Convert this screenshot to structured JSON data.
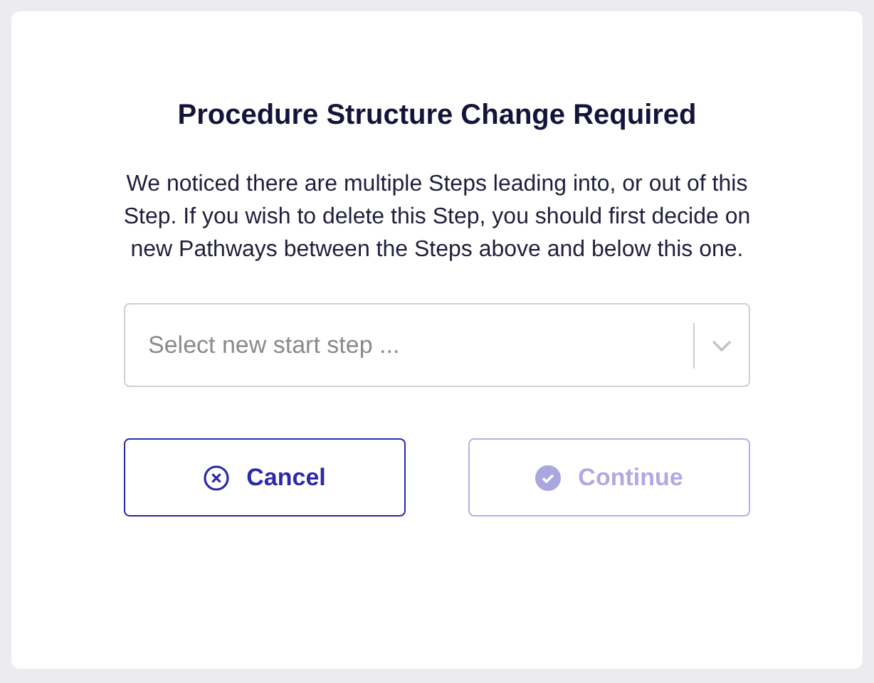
{
  "dialog": {
    "title": "Procedure Structure Change Required",
    "message": "We noticed there are multiple Steps leading into, or out of this Step. If you wish to delete this Step, you should first decide on new Pathways between the Steps above and below this one.",
    "select": {
      "placeholder": "Select new start step ..."
    },
    "buttons": [
      {
        "label": "Cancel",
        "kind": "cancel",
        "disabled": false
      },
      {
        "label": "Continue",
        "kind": "confirm",
        "disabled": true
      }
    ]
  }
}
